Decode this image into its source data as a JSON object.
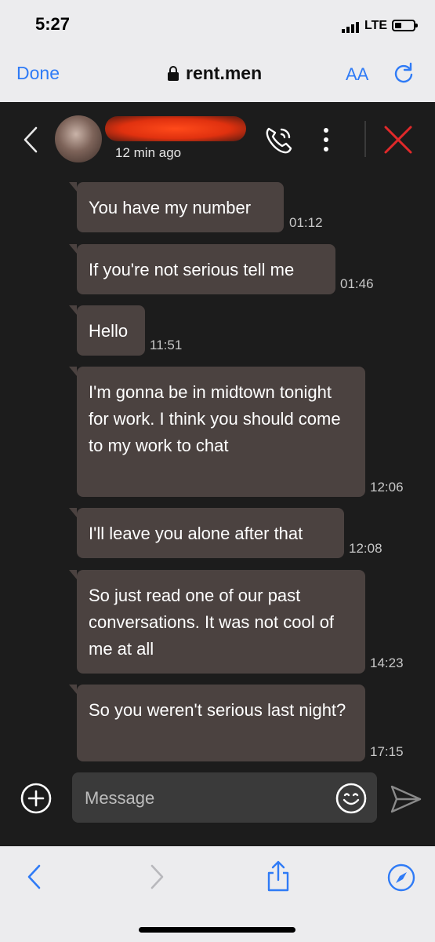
{
  "status_bar": {
    "time": "5:27",
    "network": "LTE"
  },
  "browser": {
    "done_label": "Done",
    "url": "rent.men",
    "text_size_label": "AA"
  },
  "chat_header": {
    "last_seen": "12 min ago"
  },
  "messages": [
    {
      "text": "You have my number",
      "time": "01:12"
    },
    {
      "text": "If you're not serious tell me",
      "time": "01:46"
    },
    {
      "text": "Hello",
      "time": "11:51"
    },
    {
      "text": "I'm gonna be in midtown tonight for work. I think you should come to my work to chat",
      "time": "12:06"
    },
    {
      "text": "I'll leave you alone after that",
      "time": "12:08"
    },
    {
      "text": "So just read one of our past conversations. It was not cool of me at all",
      "time": "14:23"
    },
    {
      "text": "So you weren't serious last night?",
      "time": "17:15"
    }
  ],
  "composer": {
    "placeholder": "Message"
  },
  "colors": {
    "accent": "#2f7bf6",
    "bubble": "#4b4240",
    "close": "#e0292a"
  },
  "icons": [
    "lock-icon",
    "reload-icon",
    "back-chevron-icon",
    "avatar",
    "phone-call-icon",
    "more-vertical-icon",
    "close-icon",
    "plus-circle-icon",
    "emoji-icon",
    "send-icon",
    "share-icon",
    "compass-icon"
  ]
}
